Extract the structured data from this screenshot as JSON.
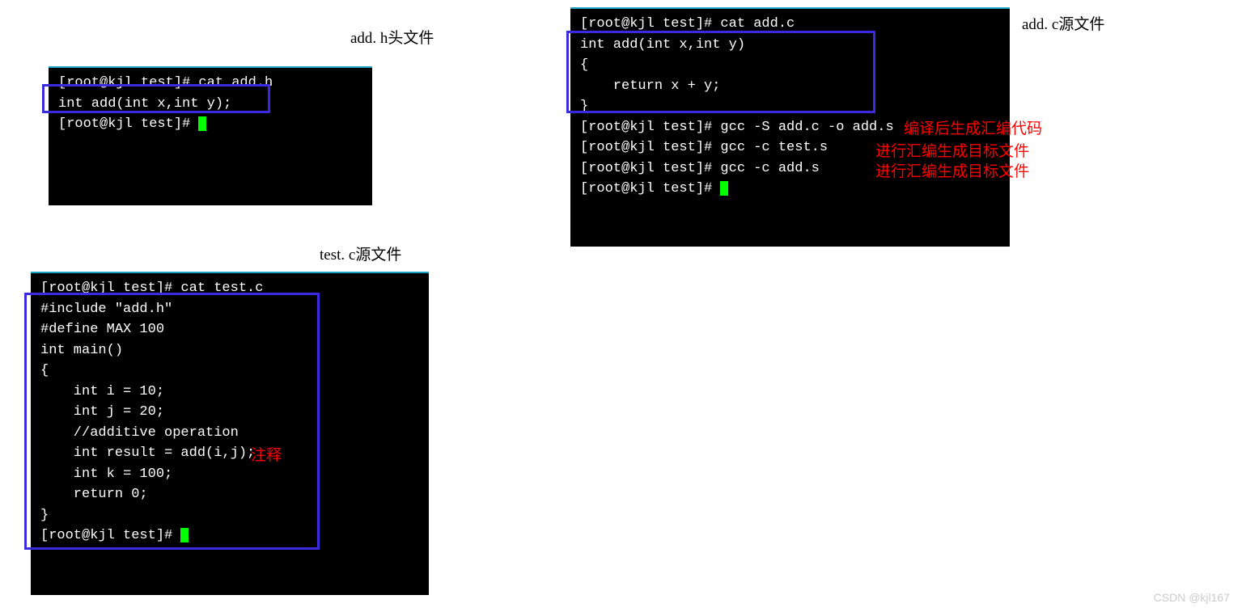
{
  "labels": {
    "add_h": "add. h头文件",
    "add_c": "add. c源文件",
    "test_c": "test. c源文件"
  },
  "term1": {
    "l1": "[root@kjl test]# cat add.h",
    "l2": "int add(int x,int y);",
    "l3": "[root@kjl test]# "
  },
  "term2": {
    "l1": "[root@kjl test]# cat add.c",
    "l2": "int add(int x,int y)",
    "l3": "{",
    "l4": "    return x + y;",
    "l5": "}",
    "l6": "[root@kjl test]# gcc -S add.c -o add.s",
    "l7": "[root@kjl test]# gcc -c test.s",
    "l8": "[root@kjl test]# gcc -c add.s",
    "l9": "[root@kjl test]# "
  },
  "term3": {
    "l1": "[root@kjl test]# cat test.c",
    "l2": "#include \"add.h\"",
    "l3": "#define MAX 100",
    "l4": "",
    "l5": "int main()",
    "l6": "{",
    "l7": "    int i = 10;",
    "l8": "    int j = 20;",
    "l9": "    //additive operation",
    "l10": "    int result = add(i,j);",
    "l11": "    int k = 100;",
    "l12": "    return 0;",
    "l13": "}",
    "l14": "[root@kjl test]# "
  },
  "annotations": {
    "comment": "注释",
    "compile": "编译后生成汇编代码",
    "asm1": "进行汇编生成目标文件",
    "asm2": "进行汇编生成目标文件"
  },
  "watermark": "CSDN @kjl167"
}
